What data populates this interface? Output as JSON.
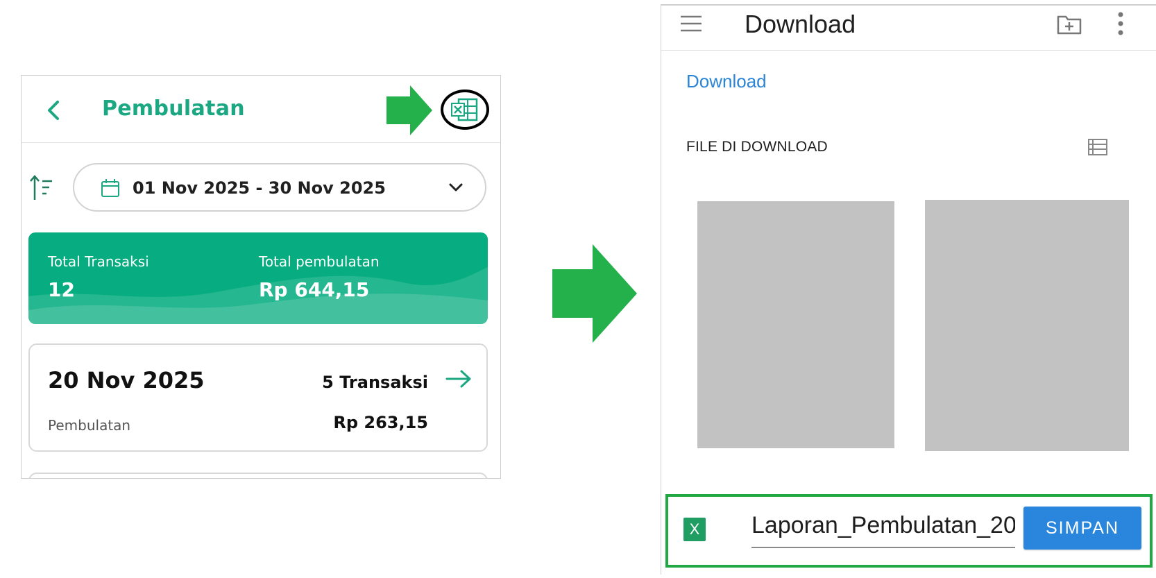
{
  "colors": {
    "app_green": "#1aa782",
    "summary_card": "#07ad80",
    "annotation_arrow": "#24b04a",
    "link_blue": "#2c84d6",
    "save_button": "#2a86dc",
    "excel_green": "#1f9d62"
  },
  "app_screen": {
    "back_icon": "chevron-left-icon",
    "title": "Pembulatan",
    "export_icon": "excel-icon",
    "sort_icon": "sort-ascending-icon",
    "date_filter": {
      "icon": "calendar-icon",
      "value": "01 Nov 2025 - 30 Nov 2025",
      "chevron": "chevron-down-icon"
    },
    "summary": {
      "total_transactions_label": "Total Transaksi",
      "total_transactions_value": "12",
      "total_rounding_label": "Total pembulatan",
      "total_rounding_value": "Rp 644,15"
    },
    "day_entries": [
      {
        "date": "20 Nov 2025",
        "count": "5 Transaksi",
        "label": "Pembulatan",
        "amount": "Rp 263,15",
        "arrow_icon": "arrow-right-icon"
      }
    ]
  },
  "file_picker": {
    "menu_icon": "hamburger-menu-icon",
    "title": "Download",
    "new_folder_icon": "new-folder-icon",
    "more_icon": "more-vertical-icon",
    "breadcrumb": "Download",
    "section_header": "FILE DI DOWNLOAD",
    "view_toggle_icon": "list-view-icon",
    "file_type_badge": "X",
    "filename": "Laporan_Pembulatan_20",
    "save_button_label": "SIMPAN"
  }
}
